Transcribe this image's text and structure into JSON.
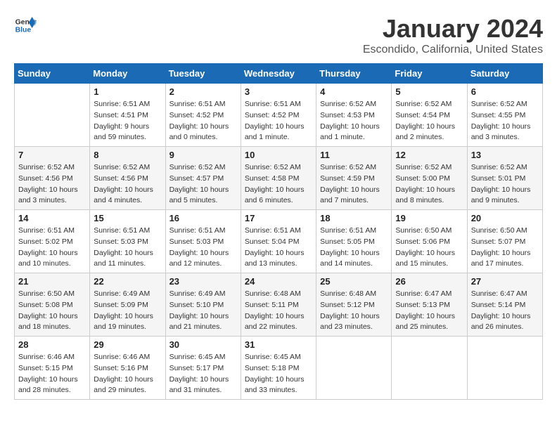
{
  "header": {
    "logo_line1": "General",
    "logo_line2": "Blue",
    "month_title": "January 2024",
    "subtitle": "Escondido, California, United States"
  },
  "days_of_week": [
    "Sunday",
    "Monday",
    "Tuesday",
    "Wednesday",
    "Thursday",
    "Friday",
    "Saturday"
  ],
  "weeks": [
    [
      {
        "day": "",
        "info": ""
      },
      {
        "day": "1",
        "info": "Sunrise: 6:51 AM\nSunset: 4:51 PM\nDaylight: 9 hours\nand 59 minutes."
      },
      {
        "day": "2",
        "info": "Sunrise: 6:51 AM\nSunset: 4:52 PM\nDaylight: 10 hours\nand 0 minutes."
      },
      {
        "day": "3",
        "info": "Sunrise: 6:51 AM\nSunset: 4:52 PM\nDaylight: 10 hours\nand 1 minute."
      },
      {
        "day": "4",
        "info": "Sunrise: 6:52 AM\nSunset: 4:53 PM\nDaylight: 10 hours\nand 1 minute."
      },
      {
        "day": "5",
        "info": "Sunrise: 6:52 AM\nSunset: 4:54 PM\nDaylight: 10 hours\nand 2 minutes."
      },
      {
        "day": "6",
        "info": "Sunrise: 6:52 AM\nSunset: 4:55 PM\nDaylight: 10 hours\nand 3 minutes."
      }
    ],
    [
      {
        "day": "7",
        "info": "Sunrise: 6:52 AM\nSunset: 4:56 PM\nDaylight: 10 hours\nand 3 minutes."
      },
      {
        "day": "8",
        "info": "Sunrise: 6:52 AM\nSunset: 4:56 PM\nDaylight: 10 hours\nand 4 minutes."
      },
      {
        "day": "9",
        "info": "Sunrise: 6:52 AM\nSunset: 4:57 PM\nDaylight: 10 hours\nand 5 minutes."
      },
      {
        "day": "10",
        "info": "Sunrise: 6:52 AM\nSunset: 4:58 PM\nDaylight: 10 hours\nand 6 minutes."
      },
      {
        "day": "11",
        "info": "Sunrise: 6:52 AM\nSunset: 4:59 PM\nDaylight: 10 hours\nand 7 minutes."
      },
      {
        "day": "12",
        "info": "Sunrise: 6:52 AM\nSunset: 5:00 PM\nDaylight: 10 hours\nand 8 minutes."
      },
      {
        "day": "13",
        "info": "Sunrise: 6:52 AM\nSunset: 5:01 PM\nDaylight: 10 hours\nand 9 minutes."
      }
    ],
    [
      {
        "day": "14",
        "info": "Sunrise: 6:51 AM\nSunset: 5:02 PM\nDaylight: 10 hours\nand 10 minutes."
      },
      {
        "day": "15",
        "info": "Sunrise: 6:51 AM\nSunset: 5:03 PM\nDaylight: 10 hours\nand 11 minutes."
      },
      {
        "day": "16",
        "info": "Sunrise: 6:51 AM\nSunset: 5:03 PM\nDaylight: 10 hours\nand 12 minutes."
      },
      {
        "day": "17",
        "info": "Sunrise: 6:51 AM\nSunset: 5:04 PM\nDaylight: 10 hours\nand 13 minutes."
      },
      {
        "day": "18",
        "info": "Sunrise: 6:51 AM\nSunset: 5:05 PM\nDaylight: 10 hours\nand 14 minutes."
      },
      {
        "day": "19",
        "info": "Sunrise: 6:50 AM\nSunset: 5:06 PM\nDaylight: 10 hours\nand 15 minutes."
      },
      {
        "day": "20",
        "info": "Sunrise: 6:50 AM\nSunset: 5:07 PM\nDaylight: 10 hours\nand 17 minutes."
      }
    ],
    [
      {
        "day": "21",
        "info": "Sunrise: 6:50 AM\nSunset: 5:08 PM\nDaylight: 10 hours\nand 18 minutes."
      },
      {
        "day": "22",
        "info": "Sunrise: 6:49 AM\nSunset: 5:09 PM\nDaylight: 10 hours\nand 19 minutes."
      },
      {
        "day": "23",
        "info": "Sunrise: 6:49 AM\nSunset: 5:10 PM\nDaylight: 10 hours\nand 21 minutes."
      },
      {
        "day": "24",
        "info": "Sunrise: 6:48 AM\nSunset: 5:11 PM\nDaylight: 10 hours\nand 22 minutes."
      },
      {
        "day": "25",
        "info": "Sunrise: 6:48 AM\nSunset: 5:12 PM\nDaylight: 10 hours\nand 23 minutes."
      },
      {
        "day": "26",
        "info": "Sunrise: 6:47 AM\nSunset: 5:13 PM\nDaylight: 10 hours\nand 25 minutes."
      },
      {
        "day": "27",
        "info": "Sunrise: 6:47 AM\nSunset: 5:14 PM\nDaylight: 10 hours\nand 26 minutes."
      }
    ],
    [
      {
        "day": "28",
        "info": "Sunrise: 6:46 AM\nSunset: 5:15 PM\nDaylight: 10 hours\nand 28 minutes."
      },
      {
        "day": "29",
        "info": "Sunrise: 6:46 AM\nSunset: 5:16 PM\nDaylight: 10 hours\nand 29 minutes."
      },
      {
        "day": "30",
        "info": "Sunrise: 6:45 AM\nSunset: 5:17 PM\nDaylight: 10 hours\nand 31 minutes."
      },
      {
        "day": "31",
        "info": "Sunrise: 6:45 AM\nSunset: 5:18 PM\nDaylight: 10 hours\nand 33 minutes."
      },
      {
        "day": "",
        "info": ""
      },
      {
        "day": "",
        "info": ""
      },
      {
        "day": "",
        "info": ""
      }
    ]
  ]
}
